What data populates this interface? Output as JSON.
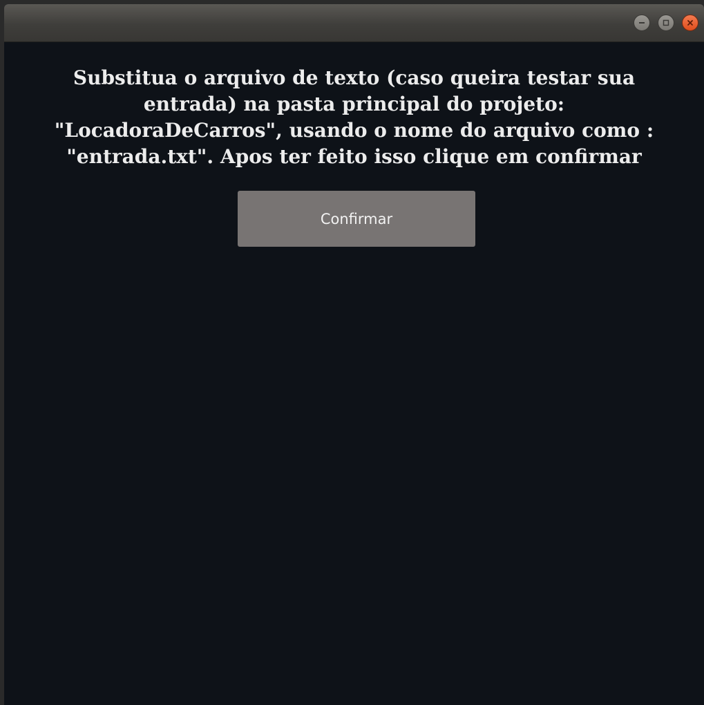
{
  "window": {
    "controls": {
      "minimize_icon": "minimize-icon",
      "maximize_icon": "maximize-icon",
      "close_icon": "close-icon"
    }
  },
  "main": {
    "message": "Substitua o arquivo de texto (caso queira testar sua\nentrada) na pasta principal do projeto:\n\"LocadoraDeCarros\", usando o nome do arquivo como :\n\"entrada.txt\". Apos ter feito isso clique em confirmar",
    "confirm_label": "Confirmar"
  },
  "colors": {
    "background": "#0e1218",
    "button": "#787473",
    "close": "#e2582a"
  }
}
